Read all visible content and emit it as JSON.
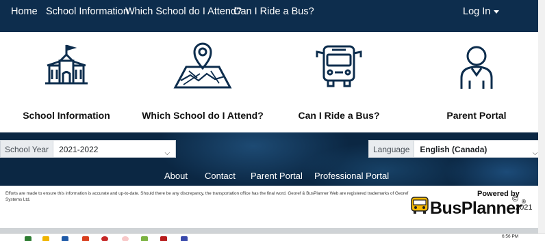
{
  "nav": {
    "items": [
      "Home",
      "School Information",
      "Which School do I Attend?",
      "Can I Ride a Bus?"
    ],
    "login_label": "Log In"
  },
  "tiles": [
    {
      "label": "School Information",
      "icon": "school-building-icon"
    },
    {
      "label": "Which School do I Attend?",
      "icon": "map-pin-icon"
    },
    {
      "label": "Can I Ride a Bus?",
      "icon": "bus-icon"
    },
    {
      "label": "Parent Portal",
      "icon": "person-icon"
    }
  ],
  "school_year": {
    "label": "School Year",
    "value": "2021-2022"
  },
  "language": {
    "label": "Language",
    "value": "English (Canada)"
  },
  "footer_links": [
    "About",
    "Contact",
    "Parent Portal",
    "Professional Portal"
  ],
  "disclaimer": "Efforts are made to ensure this information is accurate and up-to-date. Should there be any discrepancy, the transportation office has the final word. Georef & BusPlanner Web are registered trademarks of Georef Systems Ltd.",
  "branding": {
    "powered_by": "Powered by",
    "logo": "BusPlanner",
    "registered_mark": "®",
    "copyright_symbol": "©",
    "year": "2021"
  },
  "taskbar": {
    "clock": "6:56 PM"
  },
  "colors": {
    "nav_bg": "#0d2d4d",
    "band_bg": "#0b2743",
    "bus_yellow": "#f5b800"
  }
}
